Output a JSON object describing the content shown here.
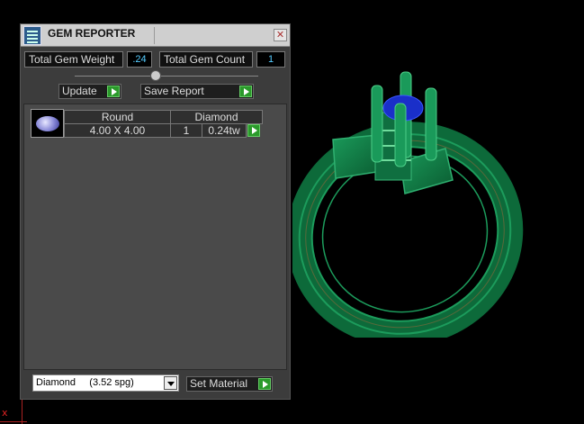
{
  "panel": {
    "title": "GEM REPORTER",
    "close_glyph": "✕",
    "total_gem_weight_label": "Total Gem Weight",
    "total_gem_weight_value": ".24",
    "total_gem_count_label": "Total Gem Count",
    "total_gem_count_value": "1",
    "update_label": "Update",
    "save_report_label": "Save Report",
    "set_material_label": "Set Material"
  },
  "gems": [
    {
      "shape": "Round",
      "material": "Diamond",
      "size": "4.00 X 4.00",
      "count": "1",
      "weight": "0.24tw"
    }
  ],
  "material_select": {
    "selected": "Diamond     (3.52 spg)"
  },
  "viewport": {
    "axis_label": "x"
  },
  "colors": {
    "ring_green": "#0f7a45",
    "stone_blue": "#1a2fc9",
    "button_green": "#2b9a2b",
    "value_cyan": "#55ccff"
  },
  "icons": [
    "gem-reporter-icon",
    "close-icon",
    "go-arrow-icon",
    "dropdown-arrow-icon",
    "gem-thumbnail-icon"
  ]
}
